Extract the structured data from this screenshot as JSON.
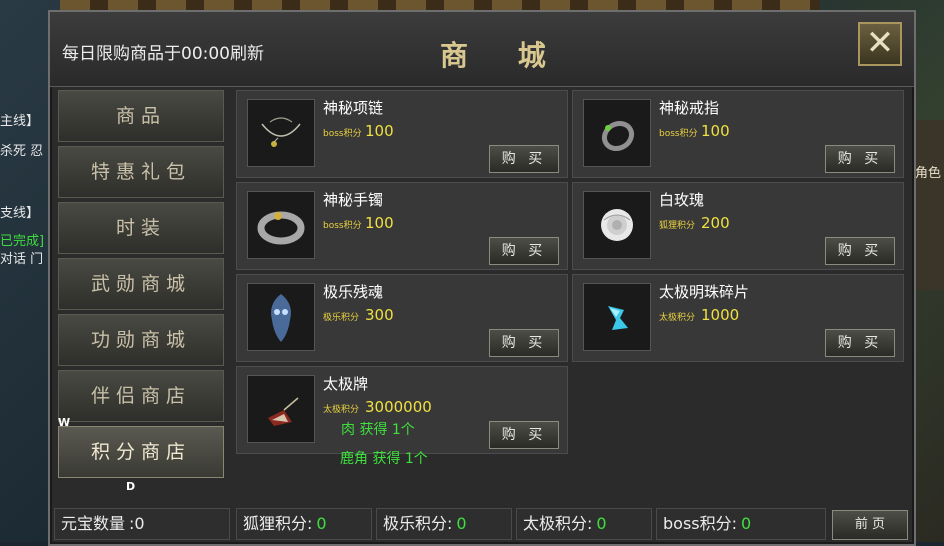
{
  "background": {
    "left_texts": [
      "主线】",
      "杀死 忍",
      "支线】",
      "已完成]",
      "对话 门",
      "W",
      "D"
    ],
    "right_text": "角色"
  },
  "header": {
    "refresh_note": "每日限购商品于00:00刷新",
    "title": "商 城",
    "close_label": "✕"
  },
  "sidebar": {
    "items": [
      {
        "label": "商品",
        "active": false
      },
      {
        "label": "特惠礼包",
        "active": false
      },
      {
        "label": "时装",
        "active": false
      },
      {
        "label": "武勋商城",
        "active": false
      },
      {
        "label": "功勋商城",
        "active": false
      },
      {
        "label": "伴侣商店",
        "active": false
      },
      {
        "label": "积分商店",
        "active": true
      }
    ]
  },
  "items": [
    {
      "name": "神秘项链",
      "currency": "boss积分",
      "price": "100",
      "buy_label": "购 买",
      "icon": "necklace-icon"
    },
    {
      "name": "神秘戒指",
      "currency": "boss积分",
      "price": "100",
      "buy_label": "购 买",
      "icon": "ring-icon"
    },
    {
      "name": "神秘手镯",
      "currency": "boss积分",
      "price": "100",
      "buy_label": "购 买",
      "icon": "bracelet-icon"
    },
    {
      "name": "白玫瑰",
      "currency": "狐狸积分",
      "price": "200",
      "buy_label": "购 买",
      "icon": "rose-icon"
    },
    {
      "name": "极乐残魂",
      "currency": "极乐积分",
      "price": "300",
      "buy_label": "购 买",
      "icon": "soul-icon"
    },
    {
      "name": "太极明珠碎片",
      "currency": "太极积分",
      "price": "1000",
      "buy_label": "购 买",
      "icon": "pearl-fragment-icon"
    },
    {
      "name": "太极牌",
      "currency": "太极积分",
      "price": "3000000",
      "buy_label": "购 买",
      "icon": "taiji-token-icon"
    }
  ],
  "gain_messages": [
    "肉 获得 1个",
    "鹿角 获得 1个"
  ],
  "footer": {
    "yuanbao": {
      "label": "元宝数量",
      "value": ":0"
    },
    "fox": {
      "label": "狐狸积分",
      "value": "0"
    },
    "jile": {
      "label": "极乐积分",
      "value": "0"
    },
    "taiji": {
      "label": "太极积分",
      "value": "0"
    },
    "boss": {
      "label": "boss积分",
      "value": "0"
    },
    "page_button": "前 页"
  },
  "colors": {
    "price": "#f0e040",
    "gain": "#3ee03e",
    "title": "#d8c890"
  }
}
